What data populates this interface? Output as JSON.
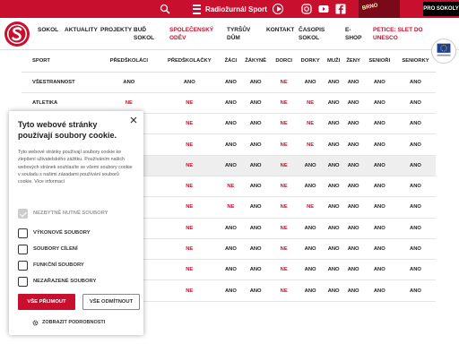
{
  "topbar": {
    "radio_label": "Radiožurnál Sport",
    "pro_sokoly": "PRO SOKOLY",
    "banner_text": "BRNO"
  },
  "nav": {
    "items": [
      [
        "SOKOL"
      ],
      [
        "AKTUALITY"
      ],
      [
        "PROJEKTY"
      ],
      [
        "BUĎ",
        "SOKOL"
      ],
      [
        "SPOLEČENSKÝ",
        "ODĚV"
      ],
      [
        "TYRŠŮV",
        "DŮM"
      ],
      [
        "KONTAKT"
      ],
      [
        "ČASOPIS",
        "SOKOL"
      ],
      [
        "E-",
        "SHOP"
      ],
      [
        "PETICE: SLET DO",
        "UNESCO"
      ]
    ]
  },
  "table": {
    "headers": [
      "SPORT",
      "PŘEDŠKOLÁCI",
      "PŘEDŠKOLAČKY",
      "ŽÁCI",
      "ŽÁKYNĚ",
      "DORCI",
      "DORKY",
      "MUŽI",
      "ŽENY",
      "SENIOŘI",
      "SENIORKY"
    ],
    "rows": [
      [
        "VŠESTRANNOST",
        "ANO",
        "ANO",
        "ANO",
        "ANO",
        "NE",
        "ANO",
        "ANO",
        "ANO",
        "ANO",
        "ANO"
      ],
      [
        "ATLETIKA",
        "NE",
        "NE",
        "ANO",
        "ANO",
        "NE",
        "NE",
        "ANO",
        "ANO",
        "ANO",
        "ANO"
      ],
      [
        "",
        "NE",
        "NE",
        "ANO",
        "ANO",
        "NE",
        "NE",
        "ANO",
        "ANO",
        "ANO",
        "ANO"
      ],
      [
        "",
        "NE",
        "NE",
        "ANO",
        "ANO",
        "NE",
        "NE",
        "ANO",
        "ANO",
        "ANO",
        "ANO"
      ],
      [
        "",
        "NE",
        "NE",
        "ANO",
        "ANO",
        "NE",
        "ANO",
        "ANO",
        "ANO",
        "ANO",
        "ANO"
      ],
      [
        "",
        "NE",
        "NE",
        "NE",
        "ANO",
        "NE",
        "ANO",
        "ANO",
        "ANO",
        "ANO",
        "ANO"
      ],
      [
        "",
        "NE",
        "NE",
        "NE",
        "ANO",
        "NE",
        "NE",
        "ANO",
        "ANO",
        "ANO",
        "ANO"
      ],
      [
        "",
        "NE",
        "NE",
        "ANO",
        "ANO",
        "NE",
        "ANO",
        "ANO",
        "ANO",
        "ANO",
        "ANO"
      ],
      [
        "",
        "NE",
        "NE",
        "ANO",
        "ANO",
        "NE",
        "ANO",
        "ANO",
        "ANO",
        "ANO",
        "ANO"
      ],
      [
        "",
        "NE",
        "NE",
        "ANO",
        "ANO",
        "NE",
        "ANO",
        "ANO",
        "ANO",
        "ANO",
        "ANO"
      ],
      [
        "",
        "NE",
        "NE",
        "ANO",
        "ANO",
        "NE",
        "ANO",
        "ANO",
        "ANO",
        "ANO",
        "ANO"
      ]
    ]
  },
  "cookie": {
    "title": "Tyto webové stránky používají soubory cookie.",
    "description": "Tyto webové stránky používají soubory cookie ke zlepšení uživatelského zážitku. Používáním našich webových stránek souhlasíte se všemi soubory cookie v souladu s našimi zásadami používání souborů cookie. Více informací",
    "options": [
      "NEZBYTNĚ NUTNÉ SOUBORY",
      "VÝKONOVÉ SOUBORY",
      "SOUBORY CÍLENÍ",
      "FUNKČNÍ SOUBORY",
      "NEZAŘAZENÉ SOUBORY"
    ],
    "accept": "VŠE PŘIJMOUT",
    "decline": "VŠE ODMÍTNOUT",
    "details": "ZOBRAZIT PODROBNOSTI"
  },
  "colors": {
    "brand": "#c8102e",
    "text": "#222222"
  }
}
